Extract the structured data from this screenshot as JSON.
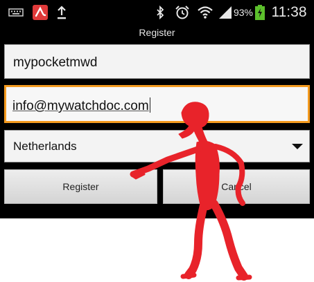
{
  "status_bar": {
    "battery": "93%",
    "time": "11:38",
    "icons": [
      "keyboard-icon",
      "avira-icon",
      "upload-icon",
      "bluetooth-icon",
      "alarm-icon",
      "wifi-icon",
      "signal-icon",
      "battery-charging-icon"
    ],
    "colors": {
      "avira": "#e03a3a",
      "battery": "#5cc02c"
    }
  },
  "title": "Register",
  "form": {
    "username_value": "mypocketmwd",
    "email_value": "info@mywatchdoc.com",
    "country_value": "Netherlands",
    "register_label": "Register",
    "cancel_label": "Cancel"
  },
  "colors": {
    "focus_border": "#f39a1f",
    "overlay_figure": "#e8232a"
  },
  "overlay": {
    "description_icon": "stick-figure-overlay"
  }
}
